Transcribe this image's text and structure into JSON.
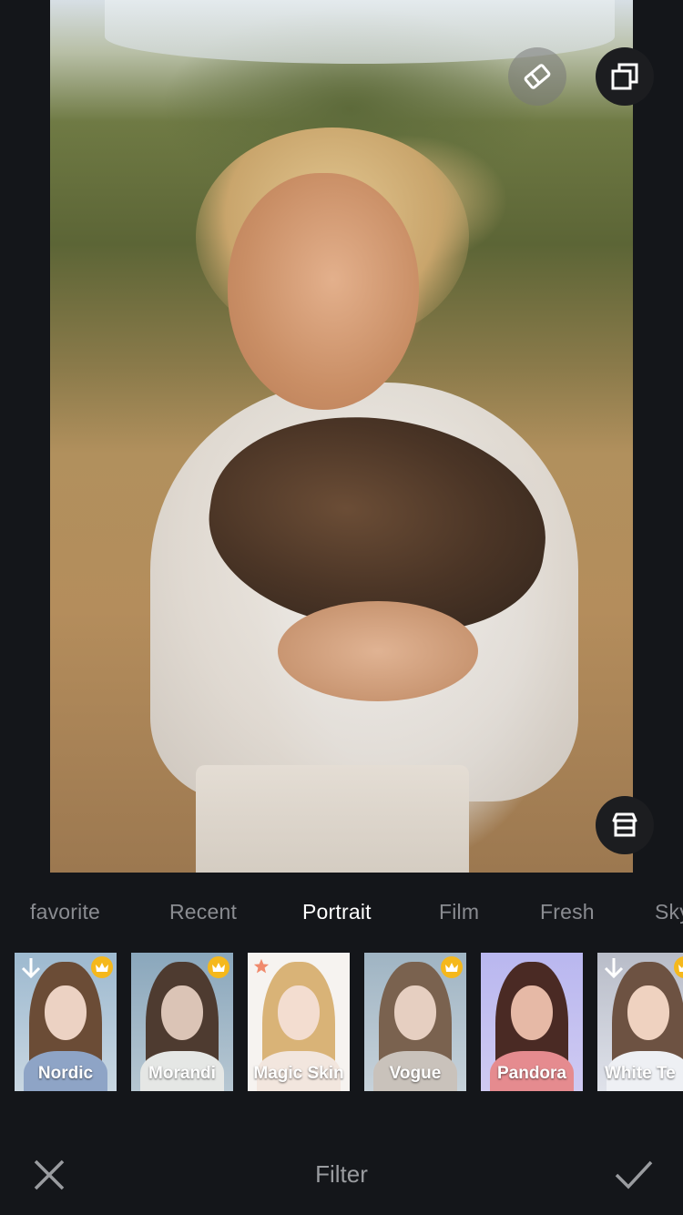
{
  "photo": {
    "subject": ""
  },
  "overlay_buttons": {
    "eraser": "eraser-icon",
    "compare": "compare-layers-icon",
    "store": "store-icon"
  },
  "categories": [
    "favorite",
    "Recent",
    "Portrait",
    "Film",
    "Fresh",
    "Sky"
  ],
  "active_category": "Portrait",
  "filters": [
    {
      "label": "Nordic",
      "badge": "download",
      "premium": true
    },
    {
      "label": "Morandi",
      "badge": "",
      "premium": true
    },
    {
      "label": "Magic Skin",
      "badge": "star",
      "premium": false
    },
    {
      "label": "Vogue",
      "badge": "",
      "premium": true
    },
    {
      "label": "Pandora",
      "badge": "",
      "premium": false
    },
    {
      "label": "White Te",
      "badge": "download",
      "premium": true
    }
  ],
  "bottom_bar": {
    "title": "Filter",
    "close_icon": "close-icon",
    "confirm_icon": "check-icon"
  },
  "colors": {
    "background": "#14161a",
    "active_tab": "#ffffff",
    "inactive_tab": "#8a8c91",
    "premium_badge": "#f5b81c",
    "star_badge": "#f08a6c"
  }
}
